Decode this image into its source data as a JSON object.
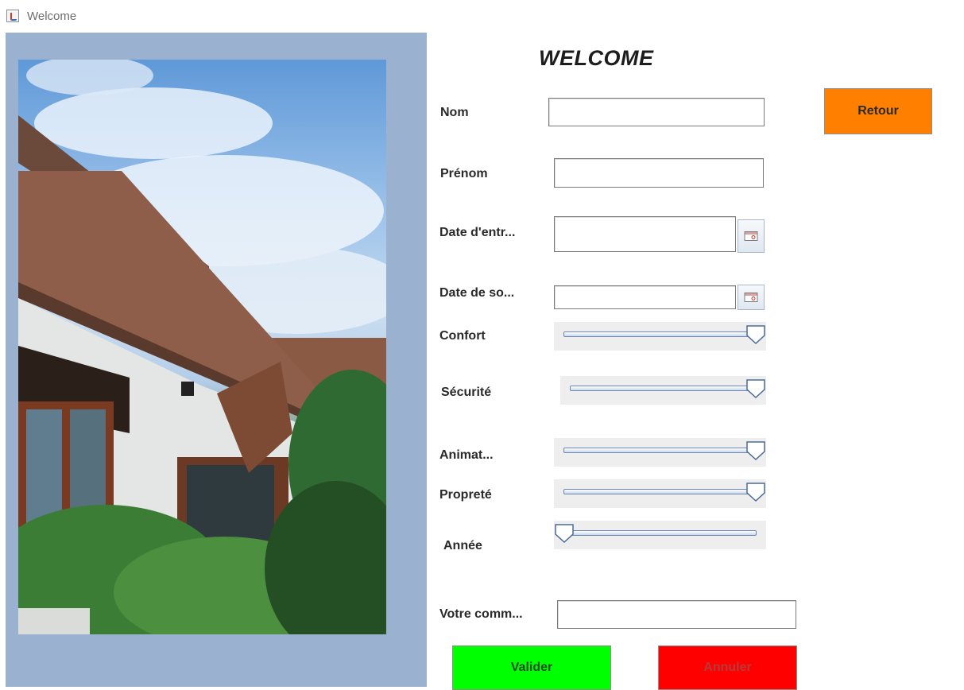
{
  "window": {
    "title": "Welcome",
    "icon": "java-app-icon"
  },
  "photo": {
    "subject": "house-photo"
  },
  "form": {
    "heading": "WELCOME",
    "nom": {
      "label": "Nom",
      "value": ""
    },
    "prenom": {
      "label": "Prénom",
      "value": ""
    },
    "date_entree": {
      "label": "Date d'entr...",
      "value": "",
      "icon": "calendar-icon"
    },
    "date_sortie": {
      "label": "Date de so...",
      "value": "",
      "icon": "calendar-icon"
    },
    "confort": {
      "label": "Confort",
      "level": 1.0
    },
    "securite": {
      "label": "Sécurité",
      "level": 1.0
    },
    "animation": {
      "label": "Animat...",
      "level": 1.0
    },
    "proprete": {
      "label": "Propreté",
      "level": 1.0
    },
    "annee": {
      "label": "Année",
      "level": 0.0
    },
    "commentaire": {
      "label": "Votre comm...",
      "value": ""
    }
  },
  "buttons": {
    "retour": {
      "label": "Retour",
      "color": "#ff8000"
    },
    "valider": {
      "label": "Valider",
      "color": "#00ff00"
    },
    "annuler": {
      "label": "Annuler",
      "color": "#ff0000"
    }
  }
}
